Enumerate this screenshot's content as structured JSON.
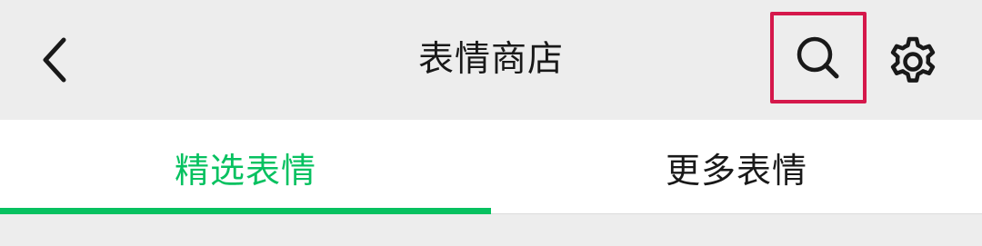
{
  "header": {
    "title": "表情商店",
    "back_icon": "chevron-left-icon",
    "search_icon": "search-icon",
    "settings_icon": "gear-icon",
    "search_highlight_color": "#d5184b"
  },
  "tabs": [
    {
      "label": "精选表情",
      "active": true
    },
    {
      "label": "更多表情",
      "active": false
    }
  ],
  "colors": {
    "accent": "#07c160",
    "text": "#191919",
    "nav_background": "#ededed",
    "tab_background": "#ffffff"
  }
}
